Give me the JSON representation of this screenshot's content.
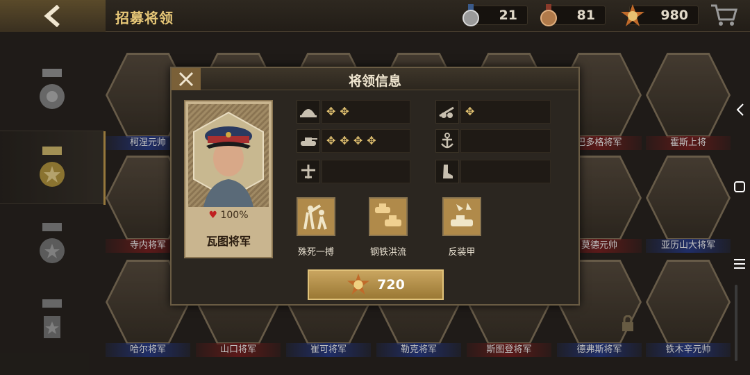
{
  "header": {
    "title": "招募将领",
    "resources": [
      {
        "icon": "silver-medal-icon",
        "value": "21"
      },
      {
        "icon": "bronze-medal-icon",
        "value": "81"
      },
      {
        "icon": "gold-star-medal-icon",
        "value": "980"
      }
    ]
  },
  "grid": {
    "cards": [
      {
        "name": "柯涅元帅",
        "band": "blue"
      },
      {
        "name": "",
        "band": "none"
      },
      {
        "name": "",
        "band": "none"
      },
      {
        "name": "",
        "band": "none"
      },
      {
        "name": "",
        "band": "none"
      },
      {
        "name": "巴多格将军",
        "band": "red"
      },
      {
        "name": "霍斯上将",
        "band": "red"
      },
      {
        "name": "寺内将军",
        "band": "red"
      },
      {
        "name": "莫德元帅",
        "band": "red"
      },
      {
        "name": "亚历山大将军",
        "band": "blue"
      },
      {
        "name": "哈尔将军",
        "band": "blue"
      },
      {
        "name": "山口将军",
        "band": "red"
      },
      {
        "name": "崔可将军",
        "band": "blue"
      },
      {
        "name": "勒克将军",
        "band": "blue"
      },
      {
        "name": "斯图登将军",
        "band": "red"
      },
      {
        "name": "德弗斯将军",
        "band": "blue"
      },
      {
        "name": "铁木辛元帅",
        "band": "blue"
      }
    ]
  },
  "modal": {
    "title": "将领信息",
    "general": {
      "name": "瓦图将军",
      "affinity": "100%"
    },
    "stats": [
      {
        "icon": "infantry-helmet-icon",
        "stars": 2
      },
      {
        "icon": "artillery-cannon-icon",
        "stars": 1
      },
      {
        "icon": "tank-icon",
        "stars": 4
      },
      {
        "icon": "navy-anchor-icon",
        "stars": 0
      },
      {
        "icon": "aircraft-icon",
        "stars": 0
      },
      {
        "icon": "boot-icon",
        "stars": 0
      }
    ],
    "skills": [
      {
        "label": "殊死一搏",
        "icon": "soldiers-charge-icon"
      },
      {
        "label": "钢铁洪流",
        "icon": "tank-column-icon"
      },
      {
        "label": "反装甲",
        "icon": "anti-tank-icon"
      }
    ],
    "buy": {
      "price": "720",
      "icon": "gold-star-medal-icon"
    }
  },
  "colors": {
    "accent": "#c9a560",
    "title": "#e8c878"
  }
}
